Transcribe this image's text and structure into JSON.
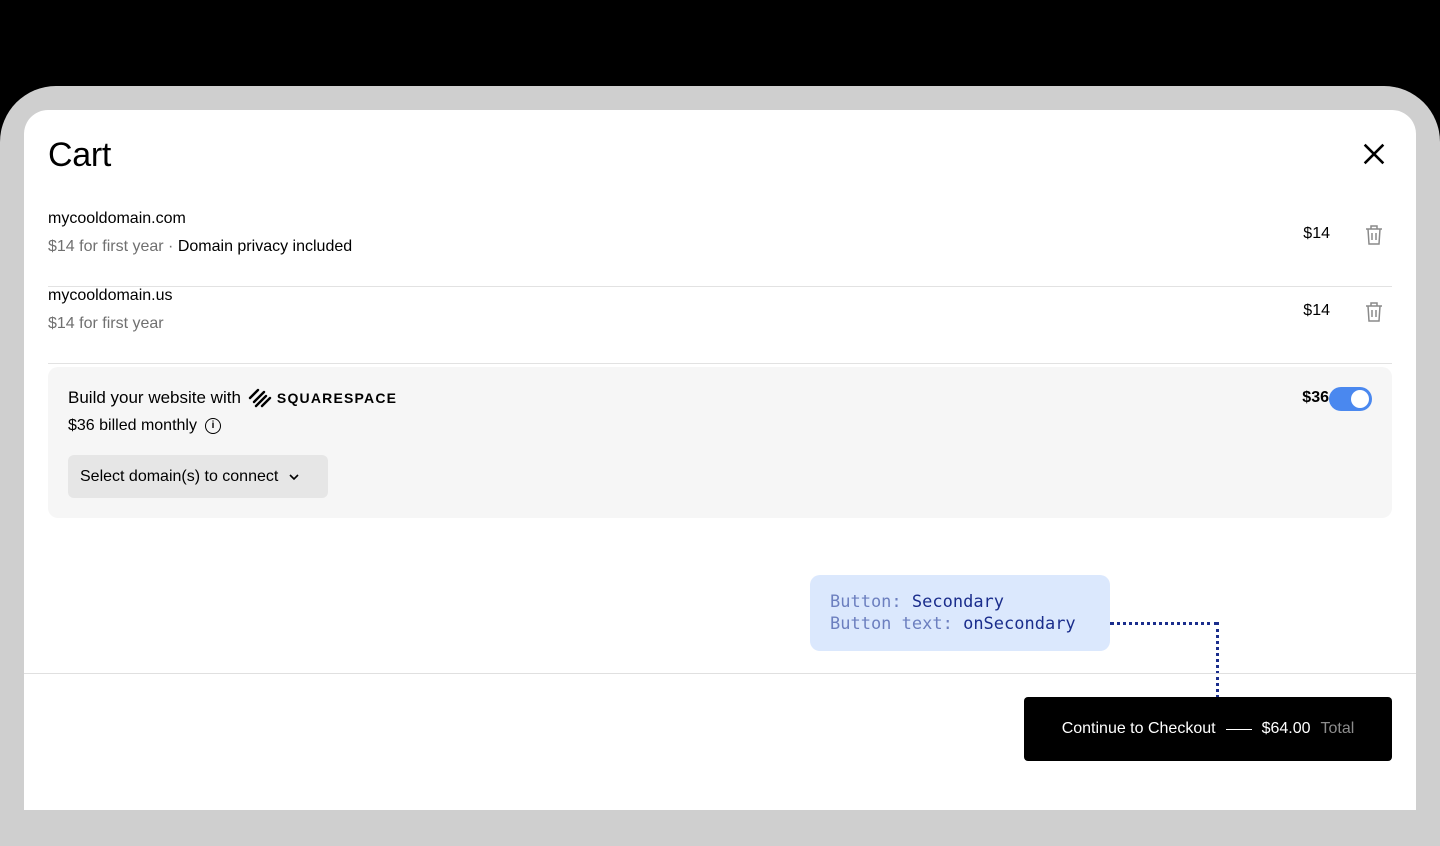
{
  "cart": {
    "title": "Cart"
  },
  "items": [
    {
      "name": "mycooldomain.com",
      "sub": "$14 for first year",
      "sub_extra": "Domain privacy included",
      "price": "$14"
    },
    {
      "name": "mycooldomain.us",
      "sub": "$14 for first year",
      "price": "$14"
    }
  ],
  "promo": {
    "headline": "Build your website with",
    "brand": "SQUARESPACE",
    "billed": "$36 billed monthly",
    "price": "$36",
    "toggle_on": true,
    "select_label": "Select domain(s) to connect"
  },
  "annotation": {
    "line1_key": "Button:",
    "line1_val": "Secondary",
    "line2_key": "Button text:",
    "line2_val": "onSecondary"
  },
  "checkout": {
    "label": "Continue to Checkout",
    "amount": "$64.00",
    "total_label": "Total"
  },
  "colors": {
    "accent": "#4a88ef",
    "annotation_bg": "#dbe8fd",
    "annotation_text": "#1a2d8c"
  }
}
